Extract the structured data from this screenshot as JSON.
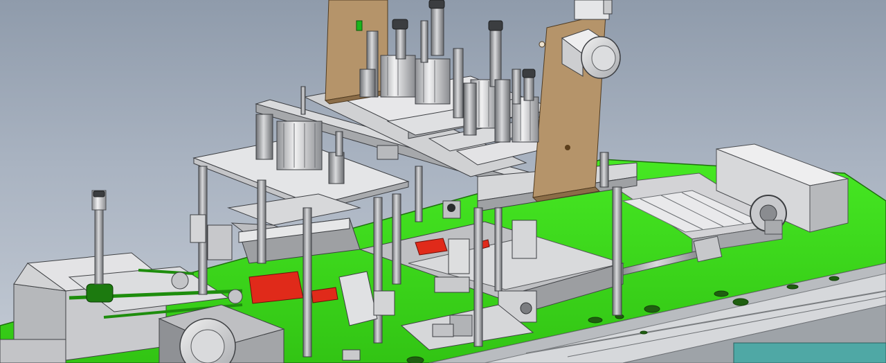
{
  "viewport": {
    "background_top": "#8f9bab",
    "background_bottom": "#c3cad4"
  },
  "model": {
    "frame_color": "#cfcfd2",
    "base_plate_color": "#3fe11d",
    "wood_panel_color": "#b5946a",
    "highlight_color": "#e02a1a",
    "rod_color": "#9a9ca0"
  }
}
